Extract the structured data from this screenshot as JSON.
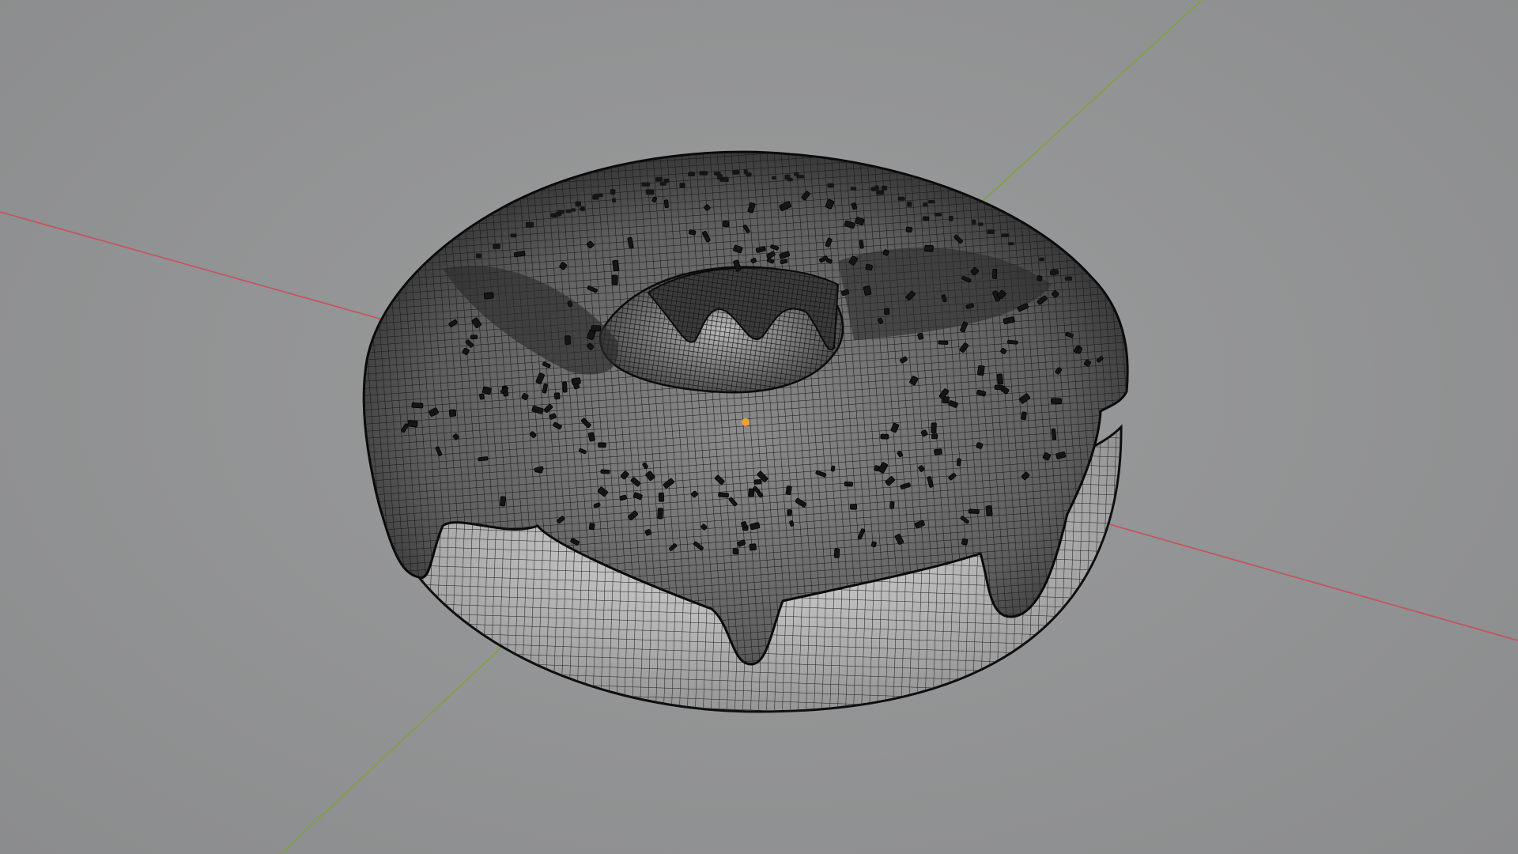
{
  "viewport": {
    "background_color": "#929394",
    "view_mode": "wireframe",
    "grid": false
  },
  "axes": {
    "x_axis_color": "#c9505c",
    "y_axis_color": "#7ea33c",
    "z_axis_visible": false
  },
  "object": {
    "name_visible": false,
    "shape": "donut-with-icing-and-sprinkles",
    "wire_color": "#121212",
    "origin_color": "#f0a030",
    "selected": false
  }
}
